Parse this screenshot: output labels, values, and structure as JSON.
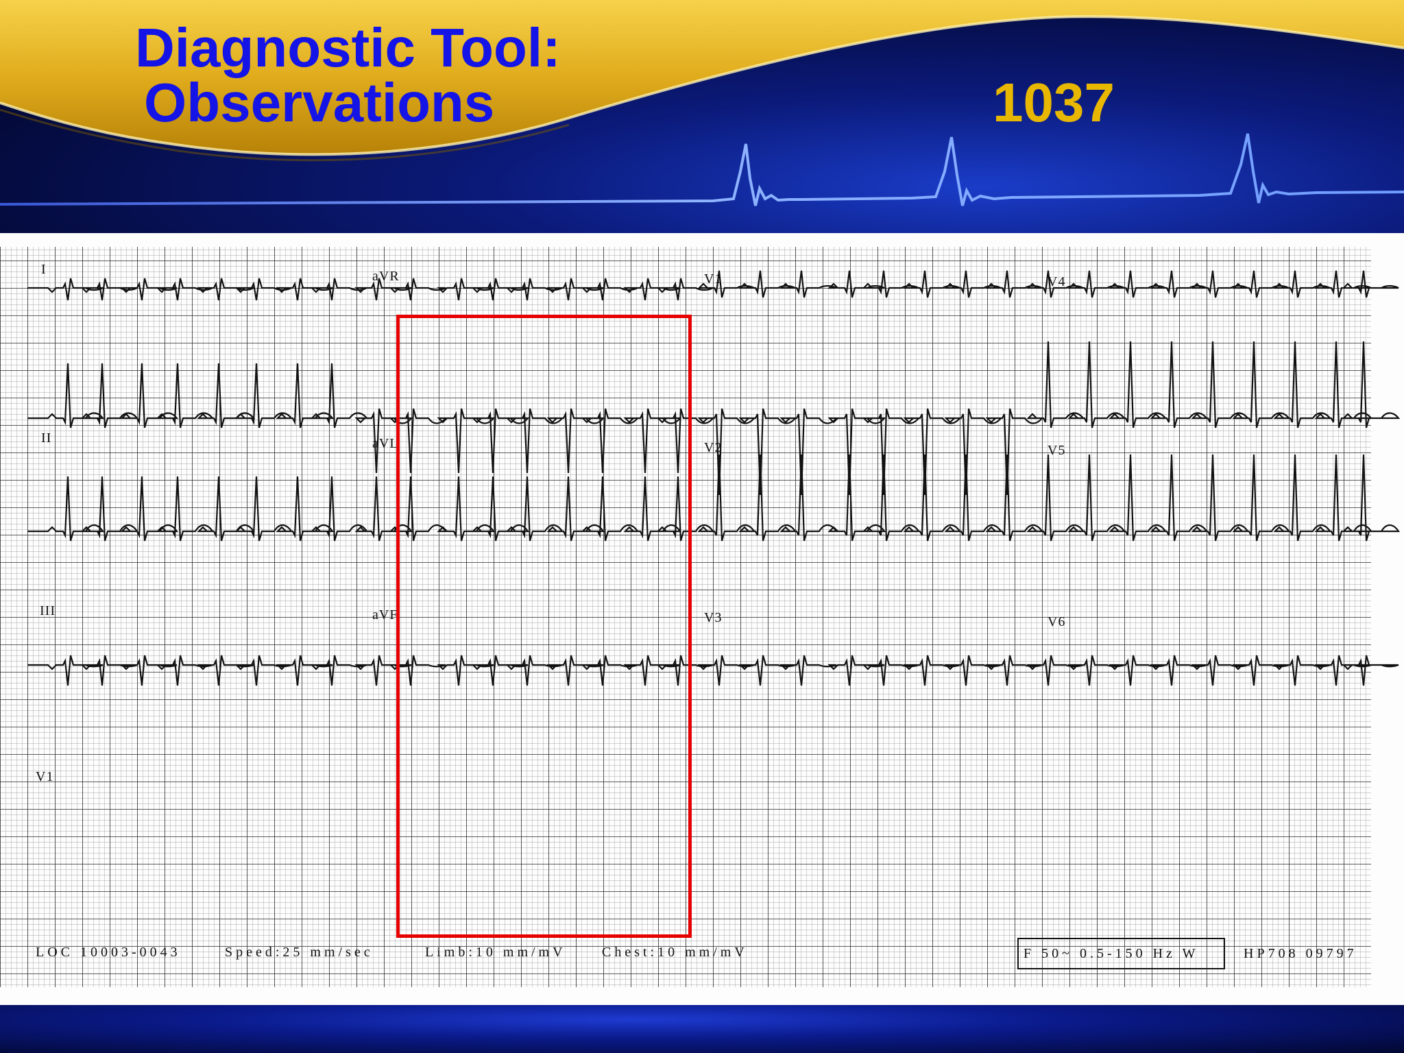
{
  "slide": {
    "title_line1": "Diagnostic Tool:",
    "title_line2": "Observations",
    "slide_number": "1037",
    "colors": {
      "title": "#1414e6",
      "number": "#e8b800",
      "highlight": "#e60000"
    }
  },
  "ecg": {
    "lead_labels": [
      "I",
      "aVR",
      "V1",
      "V4",
      "II",
      "aVL",
      "V2",
      "V5",
      "III",
      "aVF",
      "V3",
      "V6",
      "V1"
    ],
    "footer": {
      "loc": "LOC 10003-0043",
      "speed": "Speed:25 mm/sec",
      "limb": "Limb:10 mm/mV",
      "chest": "Chest:10 mm/mV",
      "filter": "F 50~ 0.5-150 Hz W",
      "device": "HP708   09797"
    },
    "highlight_label": "highlighted region"
  }
}
